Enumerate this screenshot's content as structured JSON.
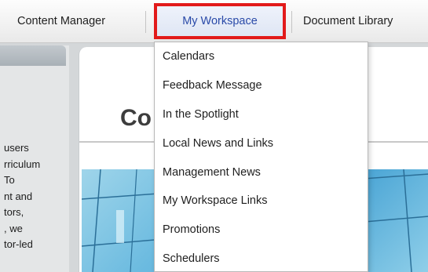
{
  "nav": {
    "items": [
      {
        "label": "Content Manager"
      },
      {
        "label": "My Workspace"
      },
      {
        "label": "Document Library"
      }
    ],
    "active_border_color": "#e21a1a"
  },
  "dropdown": {
    "items": [
      {
        "label": "Calendars"
      },
      {
        "label": "Feedback Message"
      },
      {
        "label": "In the Spotlight"
      },
      {
        "label": "Local News and Links"
      },
      {
        "label": "Management News"
      },
      {
        "label": "My Workspace Links"
      },
      {
        "label": "Promotions"
      },
      {
        "label": "Schedulers"
      }
    ]
  },
  "left_panel": {
    "lines": [
      "users",
      "rriculum",
      "To",
      "nt and",
      "tors,",
      ", we",
      "tor-led"
    ]
  },
  "main": {
    "title": "Co"
  }
}
